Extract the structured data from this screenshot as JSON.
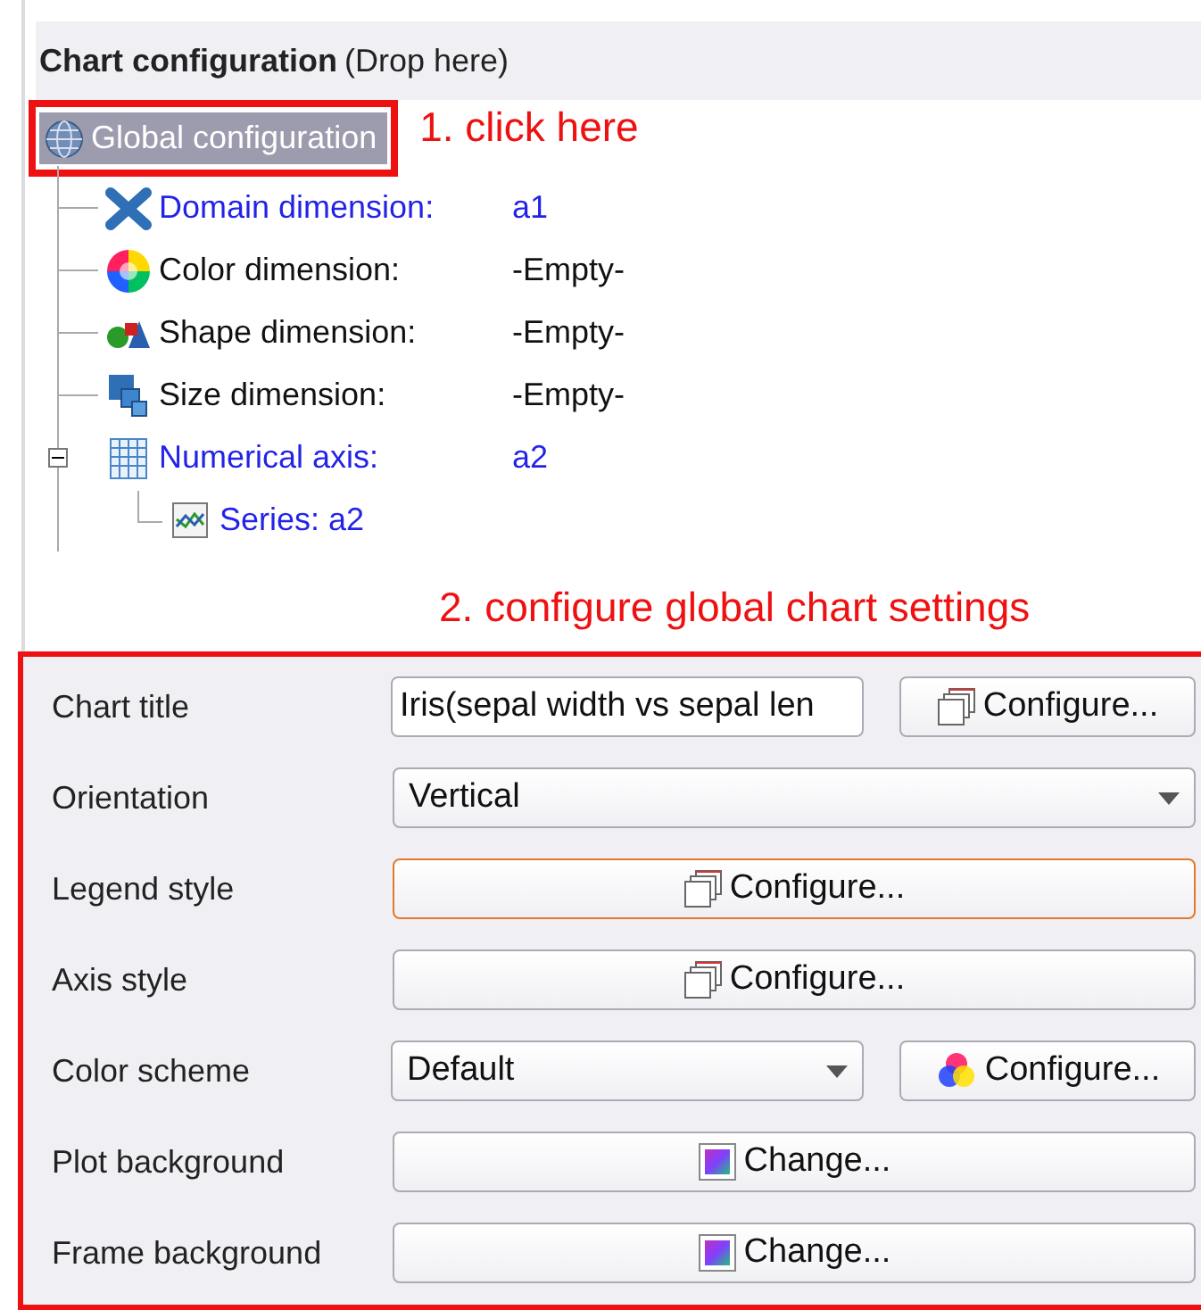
{
  "header": {
    "title": "Chart configuration",
    "hint": "(Drop here)"
  },
  "tree": {
    "label": "Global configuration",
    "selected": true,
    "children": [
      {
        "label": "Domain dimension:",
        "value": "a1",
        "linked": true
      },
      {
        "label": "Color dimension:",
        "value": "-Empty-",
        "linked": false
      },
      {
        "label": "Shape dimension:",
        "value": "-Empty-",
        "linked": false
      },
      {
        "label": "Size dimension:",
        "value": "-Empty-",
        "linked": false
      },
      {
        "label": "Numerical axis:",
        "value": "a2",
        "linked": true,
        "expanded": true,
        "children": [
          {
            "label": "Series: a2",
            "linked": true
          }
        ]
      }
    ]
  },
  "annotations": [
    "1. click here",
    "2. configure global chart settings"
  ],
  "settings": [
    {
      "label": "Chart title",
      "kind": "text",
      "value": "Iris(sepal width vs sepal len",
      "button": "Configure..."
    },
    {
      "label": "Orientation",
      "kind": "select",
      "value": "Vertical"
    },
    {
      "label": "Legend style",
      "kind": "button",
      "button": "Configure...",
      "focused": true
    },
    {
      "label": "Axis style",
      "kind": "button",
      "button": "Configure...",
      "focused": false
    },
    {
      "label": "Color scheme",
      "kind": "select",
      "value": "Default",
      "button": "Configure..."
    },
    {
      "label": "Plot background",
      "kind": "button",
      "button": "Change...",
      "focused": false
    },
    {
      "label": "Frame background",
      "kind": "button",
      "button": "Change...",
      "focused": false
    }
  ]
}
